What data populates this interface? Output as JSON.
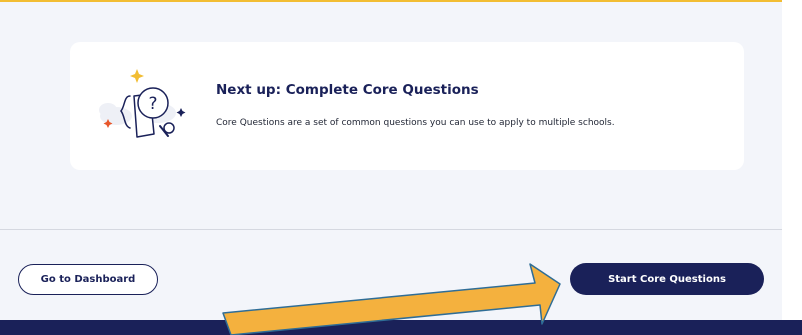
{
  "card": {
    "title": "Next up: Complete Core Questions",
    "description": "Core Questions are a set of common questions you can use to apply to multiple schools.",
    "illustration_icon": "question-document-magnifier-icon"
  },
  "buttons": {
    "dashboard_label": "Go to Dashboard",
    "start_label": "Start Core Questions"
  },
  "colors": {
    "navy": "#1a2159",
    "accent_gold": "#f2bd33",
    "page_bg": "#f3f5fa",
    "annotation_arrow": "#f4b13e"
  }
}
